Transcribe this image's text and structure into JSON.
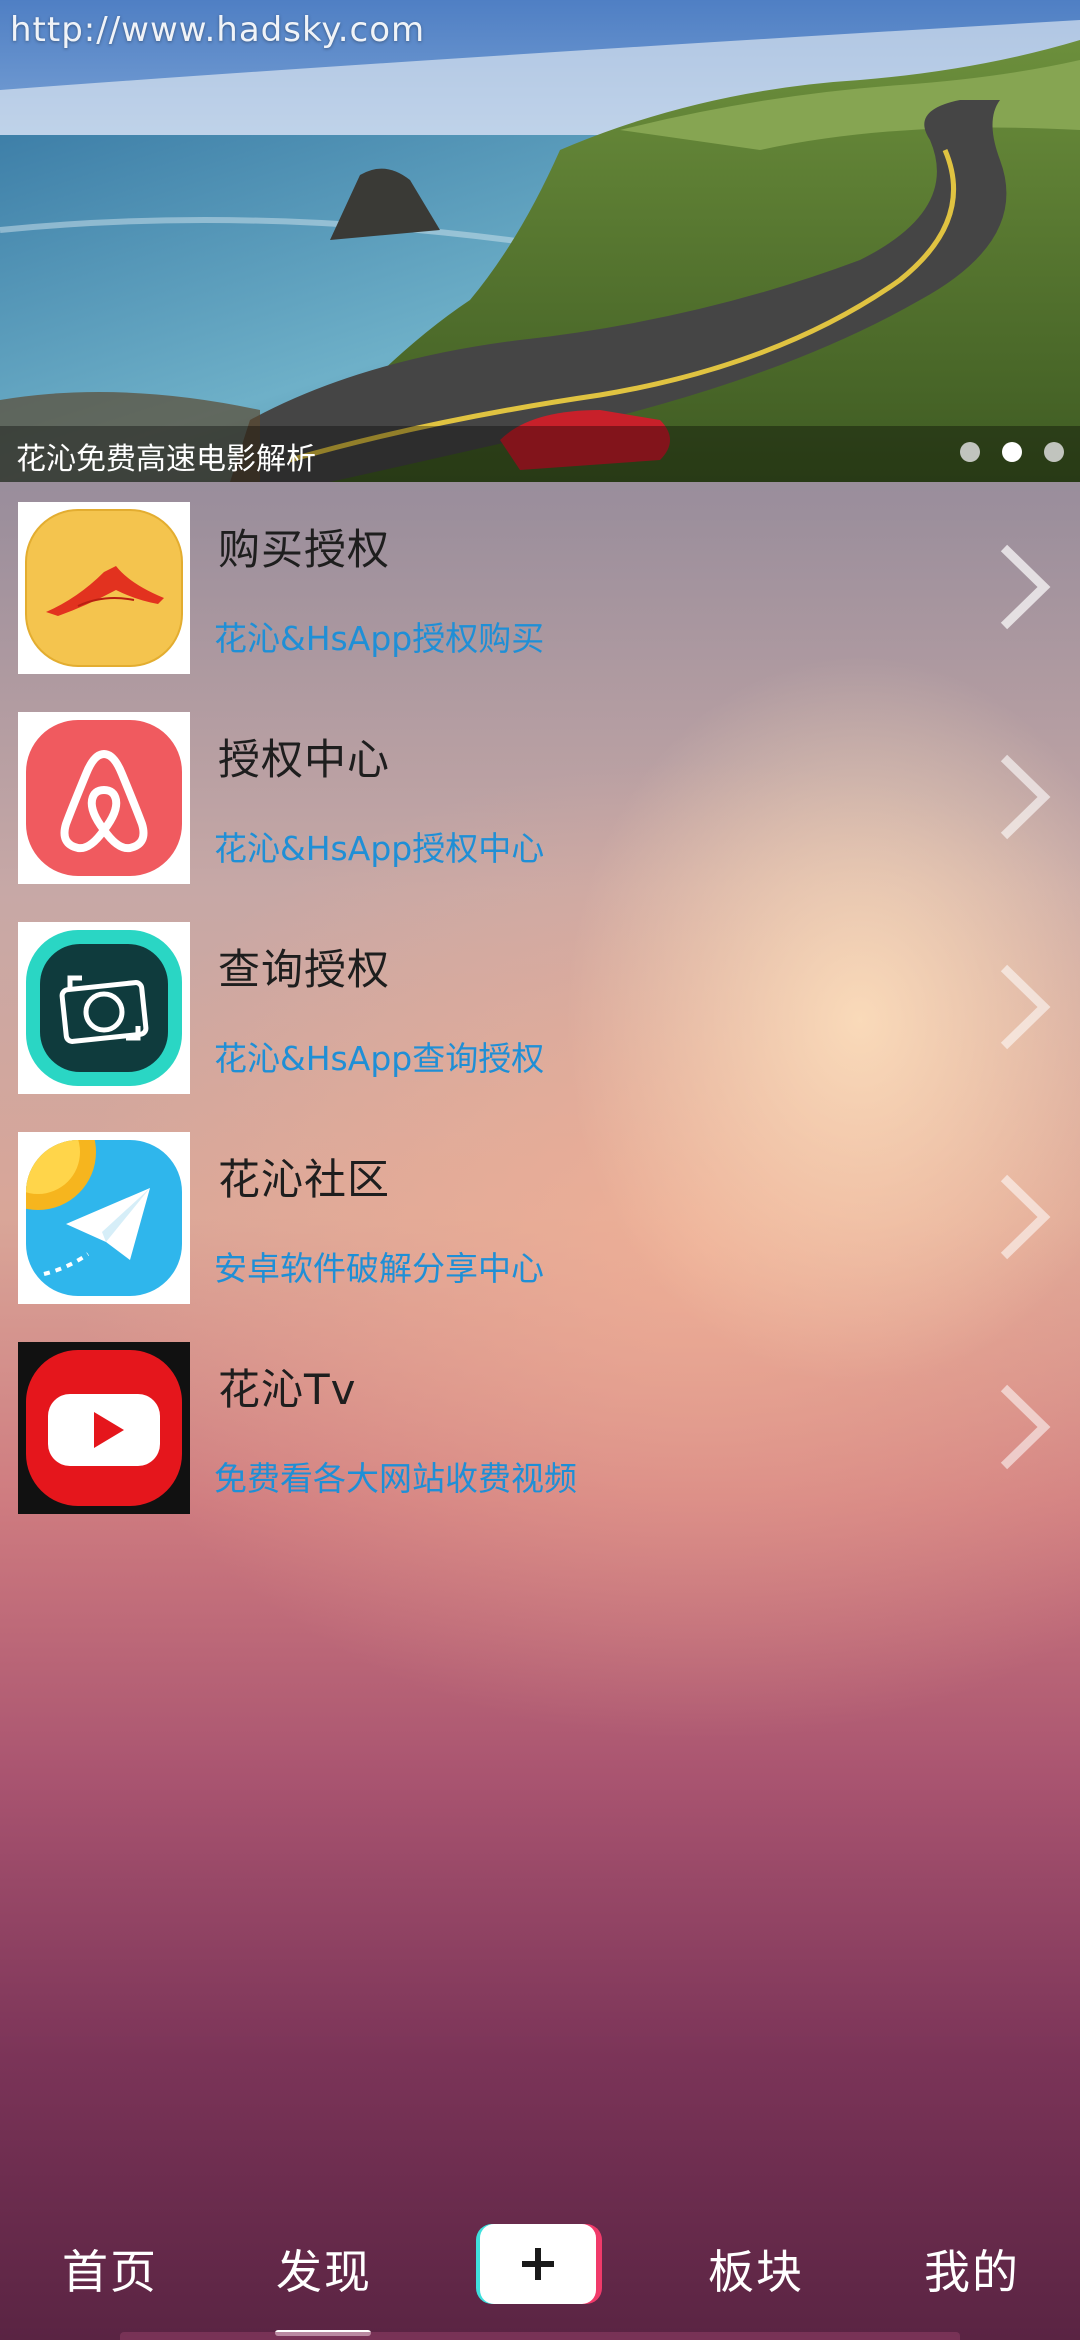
{
  "banner": {
    "url_watermark": "http://www.hadsky.com",
    "caption": "花沁免费高速电影解析",
    "dots": [
      {
        "active": false
      },
      {
        "active": true
      },
      {
        "active": false
      }
    ]
  },
  "menu": {
    "items": [
      {
        "title": "购买授权",
        "subtitle": "花沁&HsApp授权购买",
        "icon": "pizza-hut-icon"
      },
      {
        "title": "授权中心",
        "subtitle": "花沁&HsApp授权中心",
        "icon": "airbnb-icon"
      },
      {
        "title": "查询授权",
        "subtitle": "花沁&HsApp查询授权",
        "icon": "camera-scan-icon"
      },
      {
        "title": "花沁社区",
        "subtitle": "安卓软件破解分享中心",
        "icon": "telegram-icon"
      },
      {
        "title": "花沁Tv",
        "subtitle": "免费看各大网站收费视频",
        "icon": "youtube-icon"
      }
    ]
  },
  "tabbar": {
    "tabs": [
      "首页",
      "发现",
      "板块",
      "我的"
    ],
    "active_tab": "发现",
    "add_button_icon": "plus-icon"
  },
  "colors": {
    "subtitle": "#1f8fd6",
    "title": "#1e1e1e",
    "tab_text": "#ffffff",
    "add_button_left_shade": "#3fe0dd",
    "add_button_right_shade": "#f03a6a"
  }
}
